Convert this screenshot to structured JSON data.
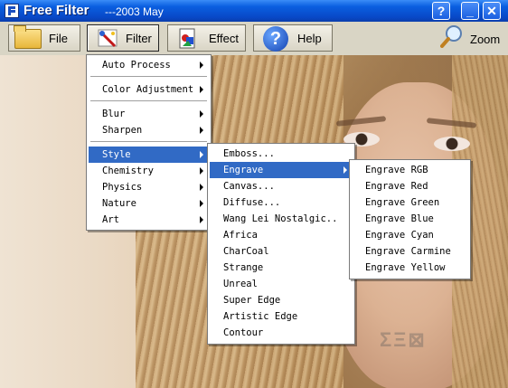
{
  "window": {
    "title": "Free Filter",
    "subtitle": "---2003 May",
    "help_btn": "?",
    "min_btn": "_",
    "close_btn": "✕"
  },
  "toolbar": {
    "file_label": "File",
    "filter_label": "Filter",
    "effect_label": "Effect",
    "help_label": "Help",
    "zoom_label": "Zoom"
  },
  "menus": {
    "main": {
      "items": [
        "Auto Process",
        "Color Adjustment",
        "Blur",
        "Sharpen",
        "Style",
        "Chemistry",
        "Physics",
        "Nature",
        "Art"
      ],
      "selected": "Style"
    },
    "style": {
      "items": [
        "Emboss...",
        "Engrave",
        "Canvas...",
        "Diffuse...",
        "Wang Lei Nostalgic..",
        "Africa",
        "CharCoal",
        "Strange",
        "Unreal",
        "Super Edge",
        "Artistic Edge",
        "Contour"
      ],
      "selected": "Engrave"
    },
    "engrave": {
      "items": [
        "Engrave RGB",
        "Engrave Red",
        "Engrave Green",
        "Engrave Blue",
        "Engrave Cyan",
        "Engrave Carmine",
        "Engrave Yellow"
      ]
    }
  },
  "icons": {
    "app": "app-icon",
    "file": "folder-icon",
    "filter": "magic-wand-icon",
    "effect": "effect-icon",
    "help": "help-icon",
    "zoom": "magnifier-icon"
  },
  "colors": {
    "titlebar": "#0a5fe0",
    "menu_highlight": "#316ac5"
  }
}
